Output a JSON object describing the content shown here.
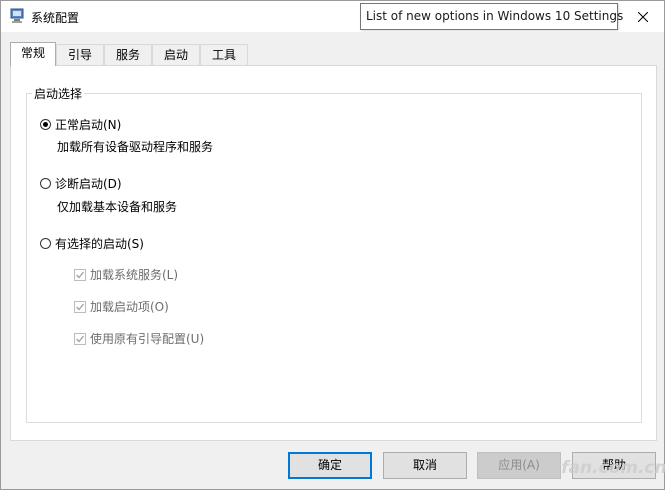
{
  "window": {
    "title": "系统配置",
    "app_icon": "msconfig-icon"
  },
  "tooltip": {
    "text": "List of new options in Windows 10 Settings"
  },
  "tabs": [
    {
      "label": "常规",
      "active": true
    },
    {
      "label": "引导",
      "active": false
    },
    {
      "label": "服务",
      "active": false
    },
    {
      "label": "启动",
      "active": false
    },
    {
      "label": "工具",
      "active": false
    }
  ],
  "startup": {
    "group_label": "启动选择",
    "normal": {
      "label": "正常启动(N)",
      "desc": "加载所有设备驱动程序和服务",
      "checked": true
    },
    "diagnostic": {
      "label": "诊断启动(D)",
      "desc": "仅加载基本设备和服务",
      "checked": false
    },
    "selective": {
      "label": "有选择的启动(S)",
      "checked": false,
      "options": [
        {
          "label": "加载系统服务(L)",
          "checked": true,
          "enabled": false
        },
        {
          "label": "加载启动项(O)",
          "checked": true,
          "enabled": false
        },
        {
          "label": "使用原有引导配置(U)",
          "checked": true,
          "enabled": false
        }
      ]
    }
  },
  "buttons": {
    "ok": "确定",
    "cancel": "取消",
    "apply": "应用(A)",
    "help": "帮助"
  },
  "colors": {
    "accent": "#0078d7",
    "disabled_text": "#6d6d6d"
  }
}
